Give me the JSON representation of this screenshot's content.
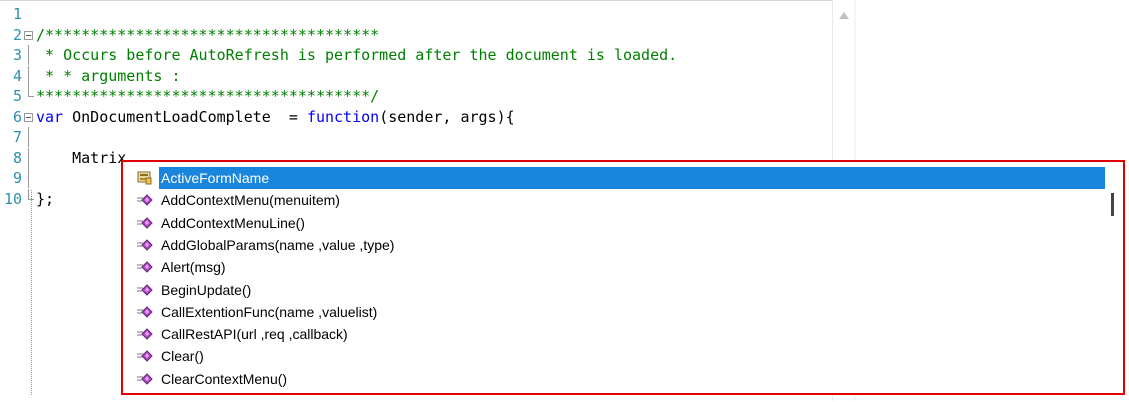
{
  "editor": {
    "lines": [
      {
        "num": "1",
        "parts": []
      },
      {
        "num": "2",
        "parts": [
          {
            "cls": "cm",
            "text": "/*************************************"
          }
        ]
      },
      {
        "num": "3",
        "parts": [
          {
            "cls": "cm",
            "text": " * Occurs before AutoRefresh is performed after the document is loaded."
          }
        ]
      },
      {
        "num": "4",
        "parts": [
          {
            "cls": "cm",
            "text": " * * arguments :"
          }
        ]
      },
      {
        "num": "5",
        "parts": [
          {
            "cls": "cm",
            "text": "*************************************/"
          }
        ]
      },
      {
        "num": "6",
        "parts": [
          {
            "cls": "kw",
            "text": "var"
          },
          {
            "cls": "plain",
            "text": " OnDocumentLoadComplete  = "
          },
          {
            "cls": "kw",
            "text": "function"
          },
          {
            "cls": "plain",
            "text": "(sender, args){"
          }
        ]
      },
      {
        "num": "7",
        "parts": []
      },
      {
        "num": "8",
        "parts": [
          {
            "cls": "plain",
            "text": "    Matrix."
          }
        ]
      },
      {
        "num": "9",
        "parts": []
      },
      {
        "num": "10",
        "parts": [
          {
            "cls": "plain",
            "text": "};"
          }
        ]
      }
    ]
  },
  "completion": {
    "items": [
      {
        "label": "ActiveFormName",
        "icon": "property-icon",
        "selected": true
      },
      {
        "label": "AddContextMenu(menuitem)",
        "icon": "method-icon"
      },
      {
        "label": "AddContextMenuLine()",
        "icon": "method-icon"
      },
      {
        "label": "AddGlobalParams(name ,value ,type)",
        "icon": "method-icon"
      },
      {
        "label": "Alert(msg)",
        "icon": "method-icon"
      },
      {
        "label": "BeginUpdate()",
        "icon": "method-icon"
      },
      {
        "label": "CallExtentionFunc(name ,valuelist)",
        "icon": "method-icon"
      },
      {
        "label": "CallRestAPI(url ,req ,callback)",
        "icon": "method-icon"
      },
      {
        "label": "Clear()",
        "icon": "method-icon"
      },
      {
        "label": "ClearContextMenu()",
        "icon": "method-icon"
      }
    ],
    "highlight_color": "#1a85dc",
    "border_color": "#e00000"
  },
  "colors": {
    "comment": "#008000",
    "keyword": "#0000ff",
    "line_number": "#2b91af"
  }
}
